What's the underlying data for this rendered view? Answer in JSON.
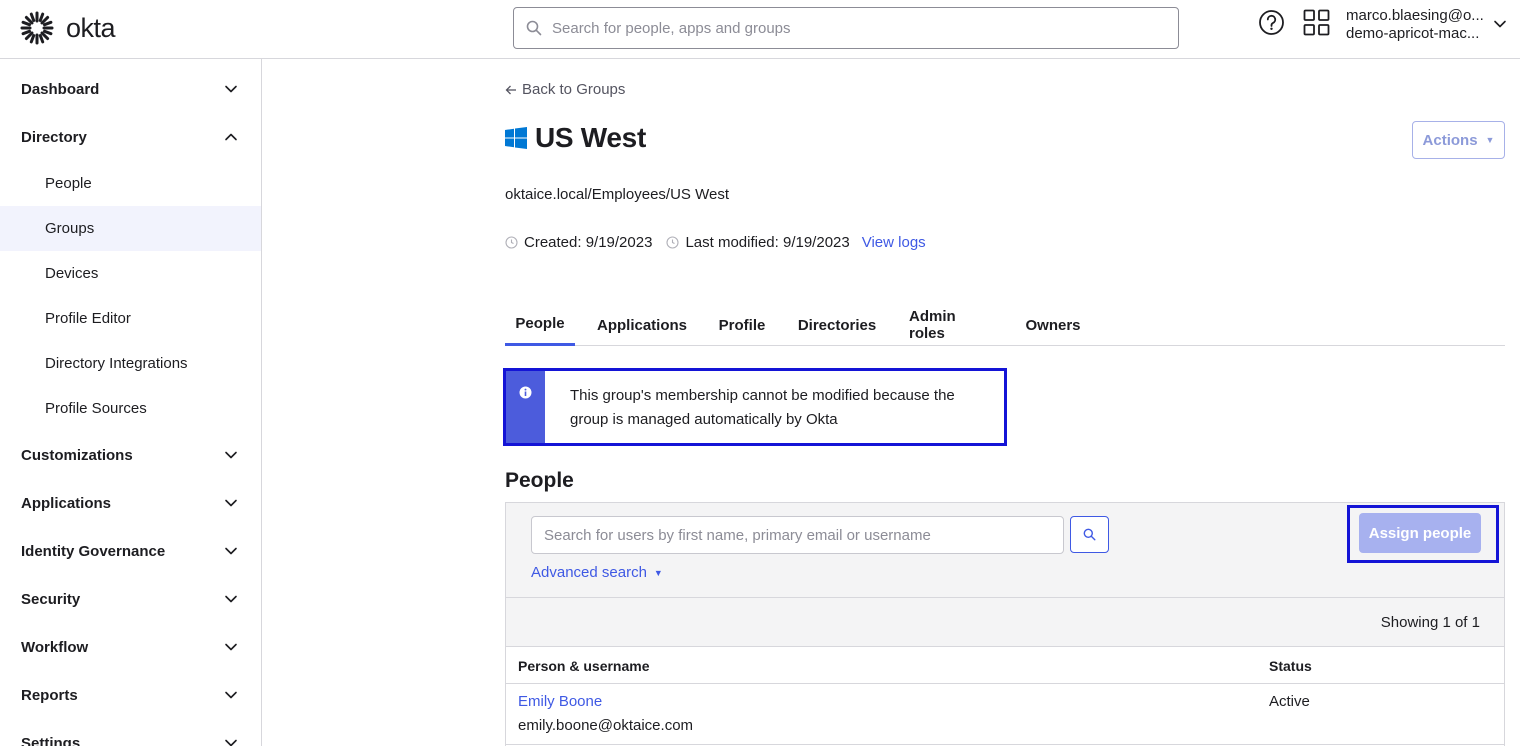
{
  "header": {
    "logo_text": "okta",
    "search_placeholder": "Search for people, apps and groups",
    "user_email": "marco.blaesing@o...",
    "user_org": "demo-apricot-mac..."
  },
  "sidebar": {
    "sections": [
      {
        "label": "Dashboard",
        "expanded": false
      },
      {
        "label": "Directory",
        "expanded": true
      },
      {
        "label": "Customizations",
        "expanded": false
      },
      {
        "label": "Applications",
        "expanded": false
      },
      {
        "label": "Identity Governance",
        "expanded": false
      },
      {
        "label": "Security",
        "expanded": false
      },
      {
        "label": "Workflow",
        "expanded": false
      },
      {
        "label": "Reports",
        "expanded": false
      },
      {
        "label": "Settings",
        "expanded": false
      }
    ],
    "directory_items": [
      "People",
      "Groups",
      "Devices",
      "Profile Editor",
      "Directory Integrations",
      "Profile Sources"
    ],
    "active_item": "Groups"
  },
  "main": {
    "back_link": "Back to Groups",
    "group_name": "US West",
    "actions_label": "Actions",
    "path": "oktaice.local/Employees/US West",
    "created": "Created: 9/19/2023",
    "last_modified": "Last modified: 9/19/2023",
    "view_logs": "View logs",
    "tabs": [
      "People",
      "Applications",
      "Profile",
      "Directories",
      "Admin roles",
      "Owners"
    ],
    "active_tab": "People",
    "callout_text": "This group's membership cannot be modified because the group is managed automatically by Okta",
    "people_heading": "People",
    "user_search_placeholder": "Search for users by first name, primary email or username",
    "advanced_search": "Advanced search",
    "assign_label": "Assign people",
    "showing": "Showing 1 of 1",
    "columns": [
      "Person & username",
      "Status"
    ],
    "rows": [
      {
        "name": "Emily Boone",
        "username": "emily.boone@oktaice.com",
        "status": "Active"
      }
    ]
  },
  "colors": {
    "accent": "#3f59e4",
    "highlight_border": "#1414d6",
    "callout_bar": "#4c5cdc",
    "disabled_button": "#a7b1ef",
    "windows_blue": "#0078d4"
  }
}
